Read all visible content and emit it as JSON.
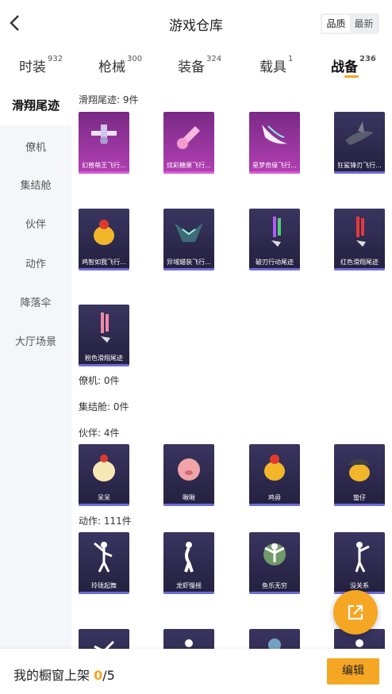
{
  "header": {
    "title": "游戏仓库",
    "sort_options": [
      "品质",
      "最新"
    ],
    "sort_active": "品质"
  },
  "tabs": [
    {
      "label": "时装",
      "count": "932"
    },
    {
      "label": "枪械",
      "count": "300"
    },
    {
      "label": "装备",
      "count": "324"
    },
    {
      "label": "载具",
      "count": "1"
    },
    {
      "label": "战备",
      "count": "236"
    }
  ],
  "sidebar": {
    "items": [
      "滑翔尾迹",
      "僚机",
      "集结舱",
      "伙伴",
      "动作",
      "降落伞",
      "大厅场景"
    ]
  },
  "sections": {
    "glide": {
      "label": "滑翔尾迹: 9件",
      "items": [
        "幻兽萌王飞行...",
        "炫彩糖果飞行...",
        "星梦奇缘飞行...",
        "狂鲨锋刃飞行...",
        "鸡智如我飞行...",
        "异域蜡装飞行...",
        "破刃行动尾迹",
        "红色滑翔尾迹",
        "粉色滑翔尾迹"
      ]
    },
    "wingman": {
      "label": "僚机: 0件"
    },
    "pod": {
      "label": "集结舱: 0件"
    },
    "partner": {
      "label": "伙伴: 4件",
      "items": [
        "呆呆",
        "啾啾",
        "鸡毋",
        "蛰仔"
      ]
    },
    "emote": {
      "label": "动作: 111件",
      "items": [
        "玲珑起舞",
        "龙虾慢摇",
        "鱼乐无穷",
        "没关系"
      ]
    }
  },
  "bottom": {
    "shelf_label": "我的橱窗上架 ",
    "shelf_current": "0",
    "shelf_total": "/5",
    "edit_label": "编辑"
  },
  "colors": {
    "accent": "#f5a623",
    "card_dark": "#2c2850",
    "card_pink": "#b33fb3"
  },
  "icons": {
    "back": "chevron-left-icon",
    "share": "share-arrow-icon"
  }
}
